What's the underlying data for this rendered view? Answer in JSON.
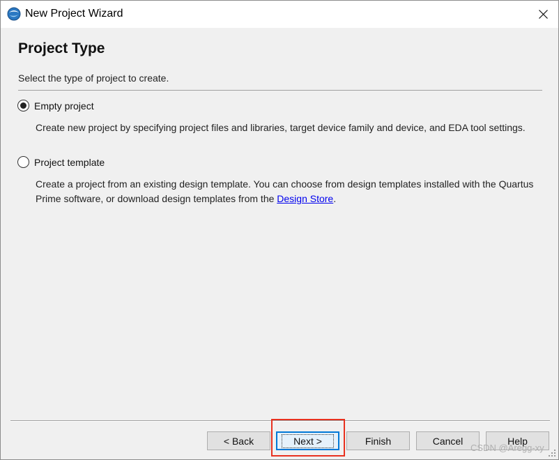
{
  "window": {
    "title": "New Project Wizard",
    "icon": "quartus-logo-icon",
    "close_icon": "close-icon"
  },
  "page": {
    "heading": "Project Type",
    "subtitle": "Select the type of project to create."
  },
  "options": [
    {
      "label": "Empty project",
      "selected": true,
      "description": "Create new project by specifying project files and libraries, target device family and device, and EDA tool settings."
    },
    {
      "label": "Project template",
      "selected": false,
      "description_before_link": "Create a project from an existing design template. You can choose from design templates installed with the Quartus Prime software, or download design templates from the ",
      "link_text": "Design Store",
      "description_after_link": "."
    }
  ],
  "buttons": {
    "back": "< Back",
    "next": "Next >",
    "finish": "Finish",
    "cancel": "Cancel",
    "help": "Help"
  },
  "watermark": "CSDN @Aregg-xy",
  "colors": {
    "highlight": "#e8311f",
    "link": "#0000ee",
    "default_button_border": "#0078d7"
  }
}
